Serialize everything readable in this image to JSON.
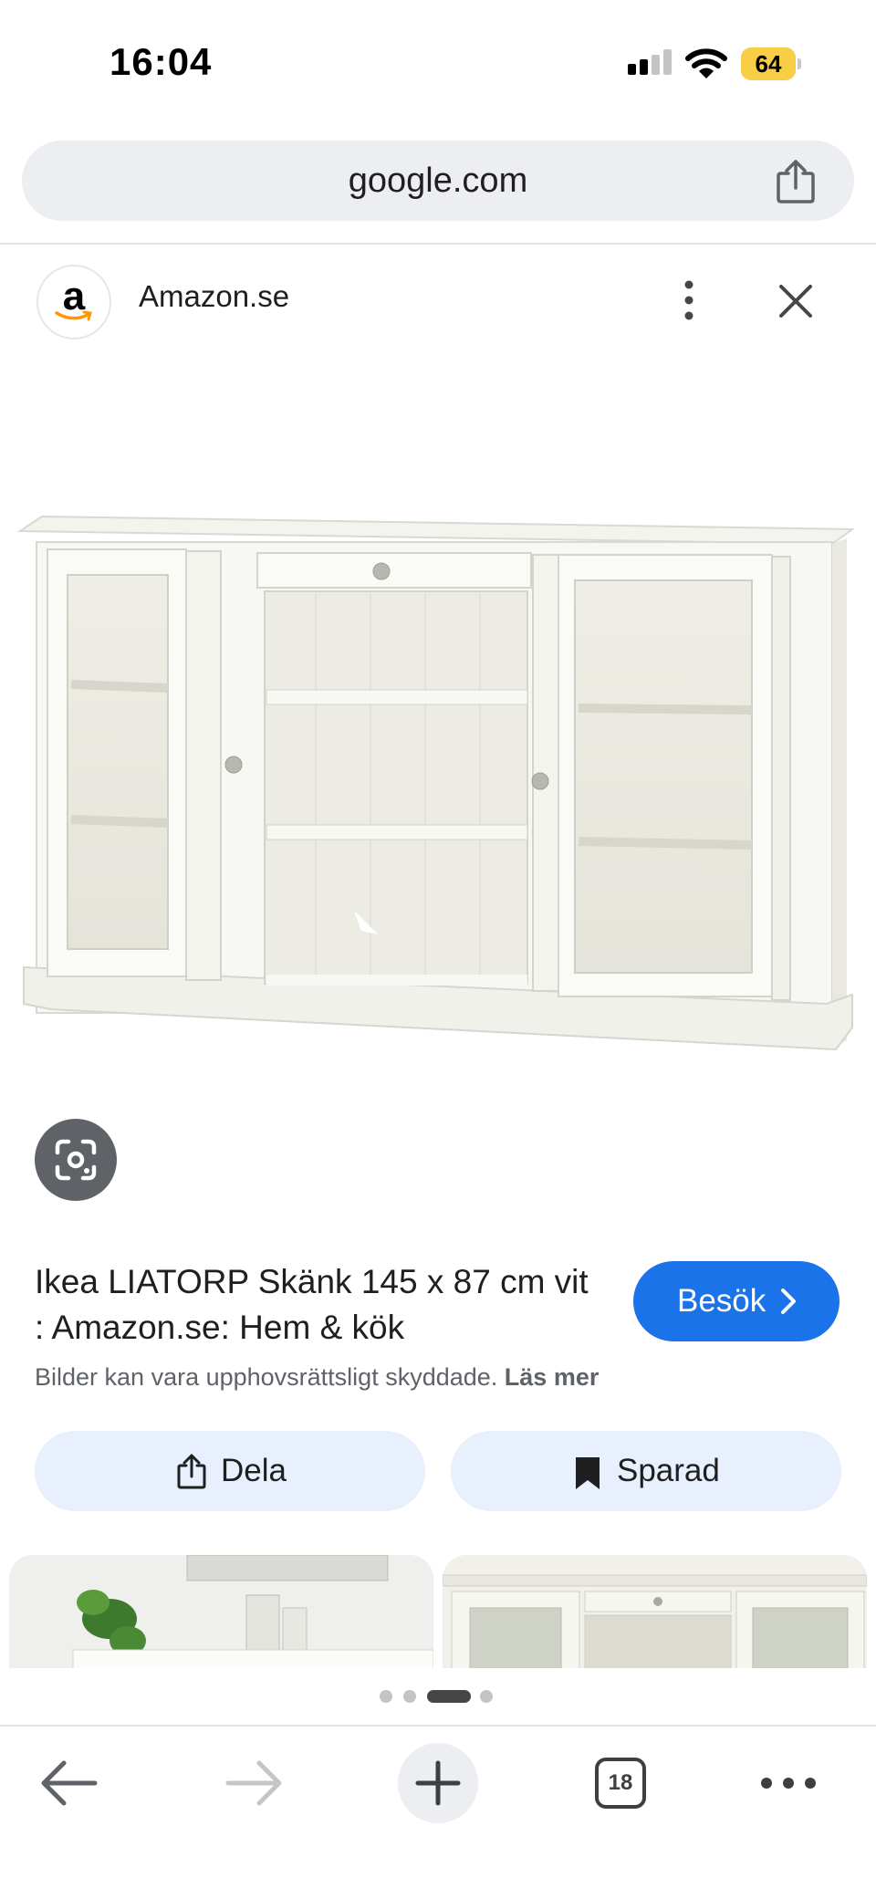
{
  "status_bar": {
    "time": "16:04",
    "battery_level": "64",
    "battery_color": "#f7ce45"
  },
  "browser": {
    "url": "google.com"
  },
  "source": {
    "logo_letter": "a",
    "name": "Amazon.se"
  },
  "result": {
    "title": "Ikea LIATORP Skänk 145 x 87 cm vit : Amazon.se: Hem & kök",
    "visit_label": "Besök",
    "copyright_notice": "Bilder kan vara upphovsrättsligt skyddade.",
    "learn_more": "Läs mer"
  },
  "actions": {
    "share_label": "Dela",
    "save_label": "Sparad"
  },
  "pager": {
    "total": 4,
    "active_index": 2
  },
  "toolbar": {
    "tab_count": "18"
  },
  "colors": {
    "accent": "#1a73e8",
    "chip_bg": "#e8f0fe",
    "url_bar_bg": "#eceef1"
  },
  "icons": [
    "signal-icon",
    "wifi-icon",
    "share-icon",
    "more-vert-icon",
    "close-icon",
    "lens-icon",
    "chevron-right-icon",
    "bookmark-icon",
    "back-arrow-icon",
    "forward-arrow-icon",
    "plus-icon",
    "more-horiz-icon"
  ]
}
